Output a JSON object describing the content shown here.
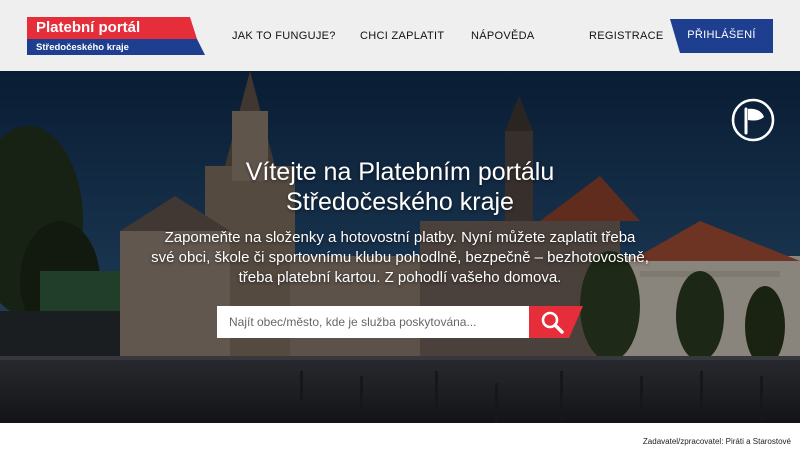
{
  "logo": {
    "title": "Platební portál",
    "subtitle": "Středočeského kraje",
    "colors": {
      "red": "#e62d3a",
      "blue": "#1e3f8f"
    }
  },
  "nav": {
    "items": [
      {
        "label": "JAK TO FUNGUJE?"
      },
      {
        "label": "CHCI ZAPLATIT"
      },
      {
        "label": "NÁPOVĚDA"
      }
    ],
    "register_label": "REGISTRACE",
    "login_label": "PŘIHLÁŠENÍ",
    "login_color": "#1e3f8f"
  },
  "hero": {
    "title_line1": "Vítejte na Platebním portálu",
    "title_line2": "Středočeského kraje",
    "lead_line1": "Zapomeňte na složenky a hotovostní platby. Nyní můžete zaplatit třeba",
    "lead_line2": "své obci, škole či sportovnímu klubu pohodlně, bezpečně – bezhotovostně,",
    "lead_line3": "třeba platební kartou. Z pohodlí vašeho domova.",
    "background": "town-square-photo",
    "party_logo_icon": "pirate-flag-icon"
  },
  "search": {
    "placeholder": "Najít obec/město, kde je služba poskytována...",
    "value": "",
    "button_icon": "search-icon",
    "button_color": "#e62d3a"
  },
  "footer": {
    "credit": "Zadavatel/zpracovatel: Piráti a Starostové"
  }
}
